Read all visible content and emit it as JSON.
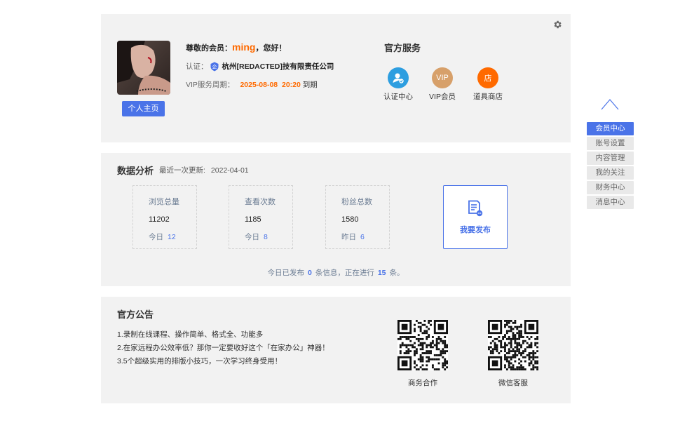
{
  "profile": {
    "greeting_prefix": "尊敬的会员：",
    "username": "ming",
    "greeting_suffix": "，您好！",
    "cert_label": "认证：",
    "company": "杭州[REDACTED]技有限责任公司",
    "vip_label": "VIP服务周期：",
    "vip_date": "2025-08-08",
    "vip_time": "20:20",
    "vip_expire": "到期",
    "home_button": "个人主页"
  },
  "services": {
    "title": "官方服务",
    "items": [
      {
        "label": "认证中心",
        "icon": "user-check-icon",
        "color": "#2d9ee0"
      },
      {
        "label": "VIP会员",
        "icon": "vip-icon",
        "icon_text": "VIP",
        "color": "#d7a06a"
      },
      {
        "label": "道具商店",
        "icon": "shop-icon",
        "icon_text": "店",
        "color": "#ff6a00"
      }
    ]
  },
  "analysis": {
    "title": "数据分析",
    "updated_label": "最近一次更新:",
    "updated_date": "2022-04-01",
    "stats": [
      {
        "label": "浏览总量",
        "value": "11202",
        "sub_label": "今日",
        "sub_value": "12"
      },
      {
        "label": "查看次数",
        "value": "1185",
        "sub_label": "今日",
        "sub_value": "8"
      },
      {
        "label": "粉丝总数",
        "value": "1580",
        "sub_label": "昨日",
        "sub_value": "6"
      }
    ],
    "publish_label": "我要发布",
    "today_prefix": "今日已发布",
    "today_published": "0",
    "today_mid": "条信息，正在进行",
    "today_ongoing": "15",
    "today_suffix": "条。"
  },
  "notice": {
    "title": "官方公告",
    "items": [
      "1.录制在线课程、操作简单、格式全、功能多",
      "2.在家远程办公效率低？那你一定要收好这个「在家办公」神器！",
      "3.5个超级实用的排版小技巧，一次学习终身受用！"
    ],
    "qr_business": "商务合作",
    "qr_wechat": "微信客服"
  },
  "side_menu": {
    "items": [
      "会员中心",
      "账号设置",
      "内容管理",
      "我的关注",
      "财务中心",
      "消息中心"
    ],
    "active_index": 0
  },
  "colors": {
    "accent": "#4a73e8",
    "highlight": "#ff6a00",
    "card_bg": "#f2f2f2"
  }
}
